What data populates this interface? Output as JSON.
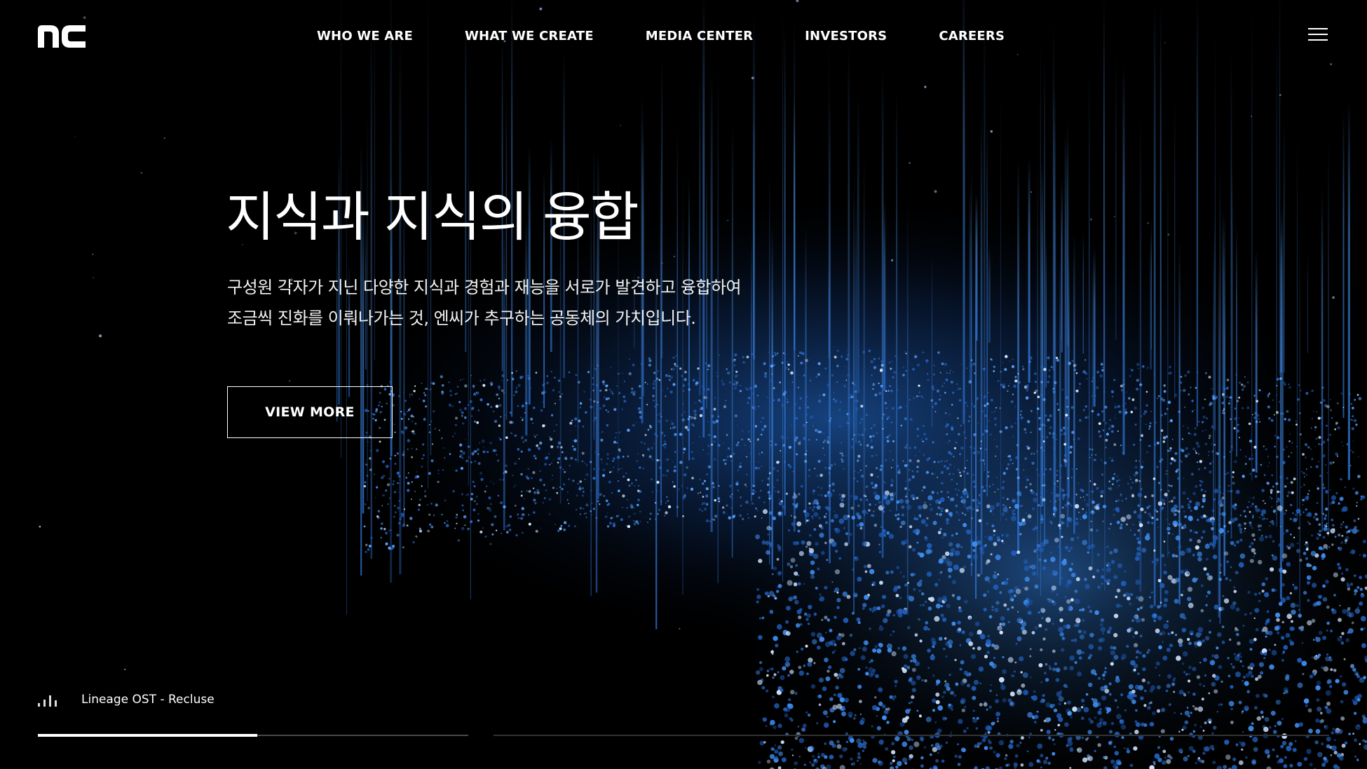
{
  "header": {
    "logo_text": "nc",
    "nav": [
      {
        "label": "WHO WE ARE"
      },
      {
        "label": "WHAT WE CREATE"
      },
      {
        "label": "MEDIA CENTER"
      },
      {
        "label": "INVESTORS"
      },
      {
        "label": "CAREERS"
      }
    ],
    "menu_icon": "hamburger-menu-icon"
  },
  "hero": {
    "title": "지식과 지식의 융합",
    "description_lines": [
      "구성원 각자가 지닌 다양한 지식과 경험과 재능을 서로가 발견하고 융합하여",
      "조금씩 진화를 이뤄나가는 것, 엔씨가 추구하는 공동체의 가치입니다."
    ],
    "cta_label": "VIEW MORE"
  },
  "player": {
    "icon": "equalizer-icon",
    "track": "Lineage OST - Recluse"
  },
  "slider": {
    "progress_fraction": 0.51
  },
  "colors": {
    "background": "#000000",
    "text": "#ffffff",
    "particle_blue": "#2f7fe0",
    "particle_light": "#9cc8ff"
  }
}
